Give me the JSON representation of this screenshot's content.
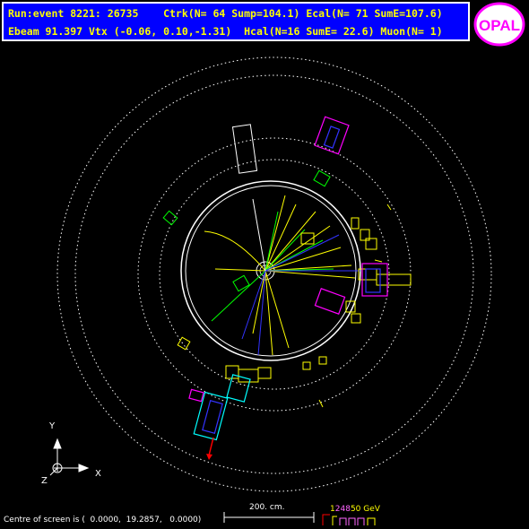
{
  "header": {
    "line1": "Run:event 8221: 26735    Ctrk(N= 64 Sump=104.1) Ecal(N= 71 SumE=107.6)",
    "line2": "Ebeam 91.397 Vtx (-0.06, 0.10,-1.31)  Hcal(N=16 SumE= 22.6) Muon(N= 1)"
  },
  "logo": {
    "text": "OPAL",
    "colors": {
      "ring": "#ff00ff",
      "text": "#ff00ff",
      "fill": "#ffffff"
    }
  },
  "footer": {
    "centre_text": "Centre of screen is (  0.0000,  19.2857,   0.0000)"
  },
  "scale": {
    "label": "200. cm."
  },
  "energy_scale": {
    "values": [
      "1",
      "2",
      "4",
      "8",
      "50 GeV"
    ],
    "colors": [
      "#ffff00",
      "#ff66ff",
      "#ff66ff",
      "#ff66ff",
      "#ffff00"
    ]
  },
  "axes": {
    "y": "Y",
    "x": "X",
    "z": "Z"
  },
  "colors": {
    "background": "#000000",
    "header_bg": "#0000ff",
    "header_text": "#ffff00",
    "tracks_yellow": "#ffff00",
    "tracks_green": "#00ff00",
    "tracks_blue": "#3333ff",
    "ecal": "#ffff00",
    "hcal": "#ff00ff",
    "muon": "#ff0000"
  }
}
